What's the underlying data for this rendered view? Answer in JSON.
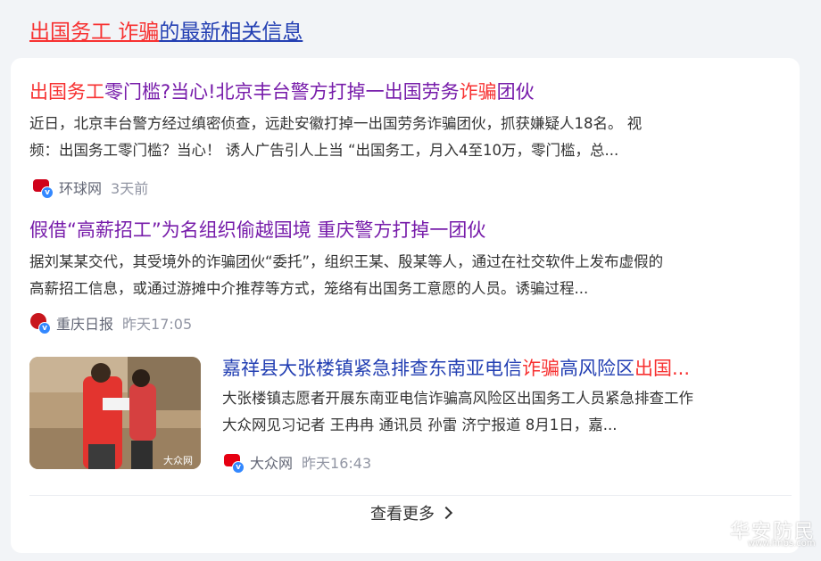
{
  "section_title": {
    "hl": "出国务工 诈骗",
    "rest": "的最新相关信息"
  },
  "items": [
    {
      "title": {
        "p1": "出国务工",
        "p2": "零门槛?当心!北京丰台警方打掉一出国劳务",
        "p3": "诈骗",
        "p4": "团伙"
      },
      "snippet1": "近日，北京丰台警方经过缜密侦查，远赴安徽打掉一出国劳务诈骗团伙，抓获嫌疑人18名。 视",
      "snippet2": "频：出国务工零门槛？当心！ 诱人广告引人上当 “出国务工，月入4至10万，零门槛，总...",
      "source": "环球网",
      "time": "3天前",
      "logo_color": "#d0021b"
    },
    {
      "title": {
        "p1": "假借“高薪招工”为名组织偷越国境 重庆警方打掉一团伙"
      },
      "snippet1": "据刘某某交代，其受境外的诈骗团伙“委托”，组织王某、殷某等人，通过在社交软件上发布虚假的",
      "snippet2": "高薪招工信息，或通过游摊中介推荐等方式，笼络有出国务工意愿的人员。诱骗过程...",
      "source": "重庆日报",
      "time": "昨天17:05",
      "logo_color": "#c8161d"
    },
    {
      "title": {
        "p1": "嘉祥县大张楼镇紧急排查东南亚电信",
        "p2": "诈骗",
        "p3": "高风险区",
        "p4": "出国..."
      },
      "snippet1": "大张楼镇志愿者开展东南亚电信诈骗高风险区出国务工人员紧急排查工作",
      "snippet2": "大众网见习记者 王冉冉 通讯员 孙雷 济宁报道 8月1日，嘉...",
      "source": "大众网",
      "time": "昨天16:43",
      "logo_color": "#e60012",
      "thumb_caption": "大众网"
    }
  ],
  "more_label": "查看更多",
  "watermark": {
    "text": "华安防民",
    "url": "www.hnbs.com"
  },
  "colors": {
    "link": "#2440b3",
    "visited": "#771caa",
    "highlight": "#f73131"
  }
}
